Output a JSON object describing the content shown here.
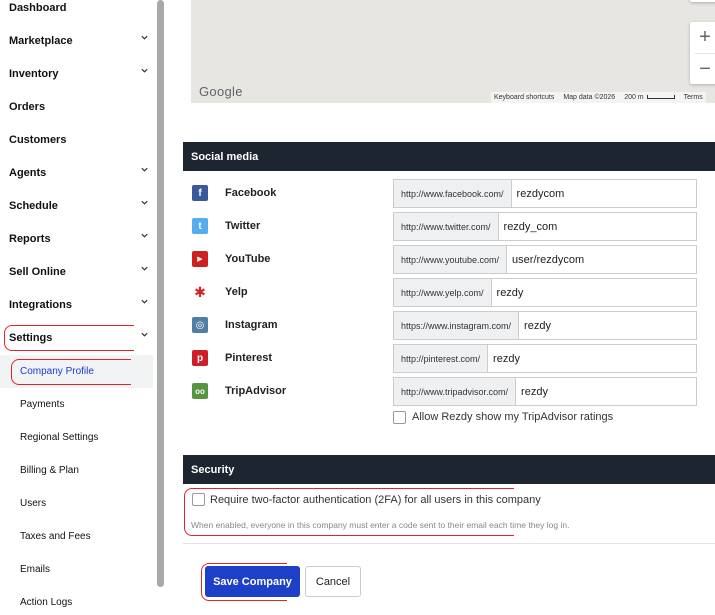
{
  "sidebar": {
    "items": [
      {
        "label": "Dashboard",
        "has_chevron": false
      },
      {
        "label": "Marketplace",
        "has_chevron": true
      },
      {
        "label": "Inventory",
        "has_chevron": true
      },
      {
        "label": "Orders",
        "has_chevron": false
      },
      {
        "label": "Customers",
        "has_chevron": false
      },
      {
        "label": "Agents",
        "has_chevron": true
      },
      {
        "label": "Schedule",
        "has_chevron": true
      },
      {
        "label": "Reports",
        "has_chevron": true
      },
      {
        "label": "Sell Online",
        "has_chevron": true
      },
      {
        "label": "Integrations",
        "has_chevron": true
      },
      {
        "label": "Settings",
        "has_chevron": true
      }
    ],
    "settings_subitems": [
      {
        "label": "Company Profile",
        "active": true
      },
      {
        "label": "Payments"
      },
      {
        "label": "Regional Settings"
      },
      {
        "label": "Billing & Plan"
      },
      {
        "label": "Users"
      },
      {
        "label": "Taxes and Fees"
      },
      {
        "label": "Emails"
      },
      {
        "label": "Action Logs"
      }
    ]
  },
  "map": {
    "logo": "Google",
    "footer": {
      "shortcuts": "Keyboard shortcuts",
      "map_data": "Map data ©2026",
      "scale": "200 m",
      "terms": "Terms"
    },
    "zoom_in": "+",
    "zoom_out": "−"
  },
  "social_media": {
    "title": "Social media",
    "rows": [
      {
        "name": "Facebook",
        "prefix": "http://www.facebook.com/",
        "value": "rezdycom",
        "icon": "facebook-icon",
        "color": "#3b5998",
        "glyph": "f"
      },
      {
        "name": "Twitter",
        "prefix": "http://www.twitter.com/",
        "value": "rezdy_com",
        "icon": "twitter-icon",
        "color": "#55acee",
        "glyph": "t"
      },
      {
        "name": "YouTube",
        "prefix": "http://www.youtube.com/",
        "value": "user/rezdycom",
        "icon": "youtube-icon",
        "color": "#cd201f",
        "glyph": "▶"
      },
      {
        "name": "Yelp",
        "prefix": "http://www.yelp.com/",
        "value": "rezdy",
        "icon": "yelp-icon",
        "color": "#d32323",
        "glyph": "✱"
      },
      {
        "name": "Instagram",
        "prefix": "https://www.instagram.com/",
        "value": "rezdy",
        "icon": "instagram-icon",
        "color": "#517fa4",
        "glyph": "◎"
      },
      {
        "name": "Pinterest",
        "prefix": "http://pinterest.com/",
        "value": "rezdy",
        "icon": "pinterest-icon",
        "color": "#cb2027",
        "glyph": "p"
      },
      {
        "name": "TripAdvisor",
        "prefix": "http://www.tripadvisor.com/",
        "value": "rezdy",
        "icon": "tripadvisor-icon",
        "color": "#589442",
        "glyph": "oo"
      }
    ],
    "tripadvisor_checkbox": "Allow Rezdy show my TripAdvisor ratings"
  },
  "security": {
    "title": "Security",
    "twofa_label": "Require two-factor authentication (2FA) for all users in this company",
    "twofa_help": "When enabled, everyone in this company must enter a code sent to their email each time they log in."
  },
  "actions": {
    "save_label": "Save Company",
    "cancel_label": "Cancel"
  },
  "colors": {
    "primary": "#1e3fc7",
    "section_header": "#1d2530",
    "highlight": "#e0242b",
    "active_link": "#1a3bd1"
  }
}
